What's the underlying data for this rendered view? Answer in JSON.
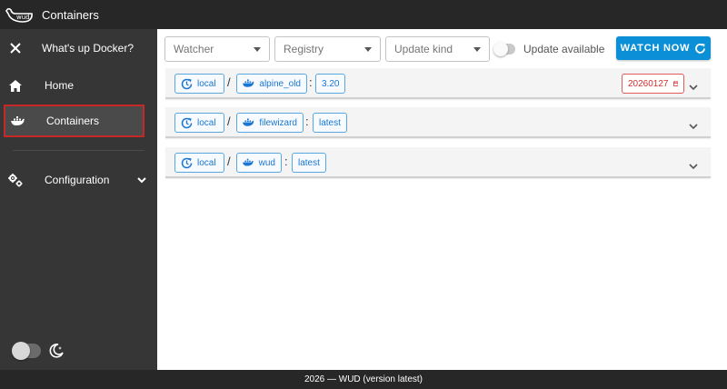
{
  "app": {
    "title": "Containers"
  },
  "sidebar": {
    "header": "What's up Docker?",
    "items": [
      {
        "label": "Home"
      },
      {
        "label": "Containers"
      },
      {
        "label": "Configuration"
      }
    ]
  },
  "toolbar": {
    "watcher_placeholder": "Watcher",
    "registry_placeholder": "Registry",
    "update_kind_placeholder": "Update kind",
    "update_available_label": "Update available",
    "watch_now_label": "WATCH NOW"
  },
  "containers": [
    {
      "watcher": "local",
      "name": "alpine_old",
      "tag": "3.20",
      "update_tag": "20260127"
    },
    {
      "watcher": "local",
      "name": "filewizard",
      "tag": "latest"
    },
    {
      "watcher": "local",
      "name": "wud",
      "tag": "latest"
    }
  ],
  "footer": {
    "text": "2026 — WUD (version latest)"
  },
  "colors": {
    "accent": "#0b8fd6",
    "chip_border": "#5aa6de",
    "update_red": "#d32f2f",
    "sidebar_bg": "#363636",
    "appbar_bg": "#272727"
  }
}
